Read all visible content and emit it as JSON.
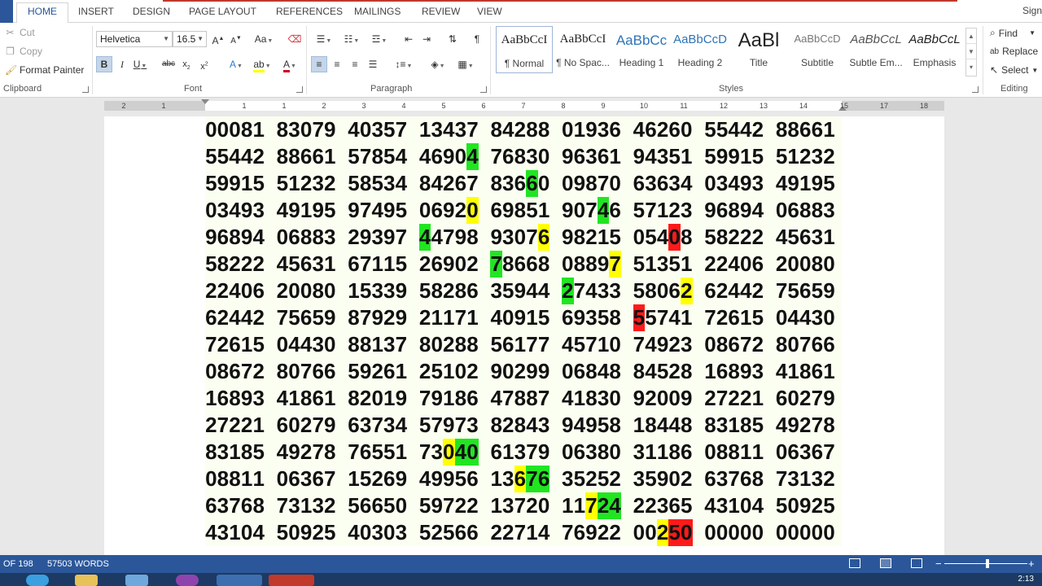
{
  "tabs": [
    "HOME",
    "INSERT",
    "DESIGN",
    "PAGE LAYOUT",
    "REFERENCES",
    "MAILINGS",
    "REVIEW",
    "VIEW"
  ],
  "active_tab": "HOME",
  "signin": "Sign",
  "clipboard": {
    "cut": "Cut",
    "copy": "Copy",
    "format_painter": "Format Painter",
    "label": "Clipboard"
  },
  "font": {
    "name": "Helvetica",
    "size": "16.5",
    "label": "Font"
  },
  "paragraph": {
    "label": "Paragraph"
  },
  "styles": {
    "label": "Styles",
    "items": [
      {
        "sample": "AaBbCcI",
        "name": "¶ Normal"
      },
      {
        "sample": "AaBbCcI",
        "name": "¶ No Spac..."
      },
      {
        "sample": "AaBbCc",
        "name": "Heading 1"
      },
      {
        "sample": "AaBbCcD",
        "name": "Heading 2"
      },
      {
        "sample": "AaBl",
        "name": "Title"
      },
      {
        "sample": "AaBbCcD",
        "name": "Subtitle"
      },
      {
        "sample": "AaBbCcL",
        "name": "Subtle Em..."
      },
      {
        "sample": "AaBbCcL",
        "name": "Emphasis"
      }
    ]
  },
  "editing": {
    "find": "Find",
    "replace": "Replace",
    "select": "Select",
    "label": "Editing"
  },
  "ruler_numbers": [
    "2",
    "1",
    "1",
    "1",
    "2",
    "3",
    "4",
    "5",
    "6",
    "7",
    "8",
    "9",
    "10",
    "11",
    "12",
    "13",
    "14",
    "15",
    "17",
    "18"
  ],
  "document": {
    "rows": [
      "00081 83079 40357 13437 84288 01936 46260 55442 88661",
      "55442 88661 57854 46904 76830 96361 94351 59915 51232",
      "59915 51232 58534 84267 83660 09870 63634 03493 49195",
      "03493 49195 97495 06920 69851 90746 57123 96894 06883",
      "96894 06883 29397 44798 93076 98215 05408 58222 45631",
      "58222 45631 67115 26902 78668 08897 51351 22406 20080",
      "22406 20080 15339 58286 35944 27433 58062 62442 75659",
      "62442 75659 87929 21171 40915 69358 55741 72615 04430",
      "72615 04430 88137 80288 56177 45710 74923 08672 80766",
      "08672 80766 59261 25102 90299 06848 84528 16893 41861",
      "16893 41861 82019 79186 47887 41830 92009 27221 60279",
      "27221 60279 63734 57973 82843 94958 18448 83185 49278",
      "83185 49278 76551 73040 61379 06380 31186 08811 06367",
      "08811 06367 15269 49956 13676 35252 35902 63768 73132",
      "63768 73132 56650 59722 13720 11724 22365 43104 50925",
      "43104 50925 40303 52566 22714 76922 00250 00000 00000"
    ],
    "highlights": [
      {
        "row": 1,
        "group": 3,
        "digit": 4,
        "color": "green"
      },
      {
        "row": 2,
        "group": 4,
        "digit": 3,
        "color": "green"
      },
      {
        "row": 3,
        "group": 3,
        "digit": 4,
        "color": "yellow"
      },
      {
        "row": 3,
        "group": 5,
        "digit": 3,
        "color": "green"
      },
      {
        "row": 4,
        "group": 3,
        "digit": 0,
        "color": "green"
      },
      {
        "row": 4,
        "group": 4,
        "digit": 4,
        "color": "yellow"
      },
      {
        "row": 4,
        "group": 6,
        "digit": 3,
        "color": "red"
      },
      {
        "row": 5,
        "group": 4,
        "digit": 0,
        "color": "green"
      },
      {
        "row": 5,
        "group": 5,
        "digit": 4,
        "color": "yellow"
      },
      {
        "row": 6,
        "group": 5,
        "digit": 0,
        "color": "green"
      },
      {
        "row": 6,
        "group": 6,
        "digit": 4,
        "color": "yellow"
      },
      {
        "row": 7,
        "group": 6,
        "digit": 0,
        "color": "red"
      },
      {
        "row": 12,
        "group": 3,
        "digit": 2,
        "color": "yellow"
      },
      {
        "row": 12,
        "group": 3,
        "digit": 3,
        "color": "green"
      },
      {
        "row": 12,
        "group": 3,
        "digit": 4,
        "color": "green"
      },
      {
        "row": 13,
        "group": 4,
        "digit": 2,
        "color": "yellow"
      },
      {
        "row": 13,
        "group": 4,
        "digit": 3,
        "color": "green"
      },
      {
        "row": 13,
        "group": 4,
        "digit": 4,
        "color": "green"
      },
      {
        "row": 14,
        "group": 5,
        "digit": 2,
        "color": "yellow"
      },
      {
        "row": 14,
        "group": 5,
        "digit": 3,
        "color": "green"
      },
      {
        "row": 14,
        "group": 5,
        "digit": 4,
        "color": "green"
      },
      {
        "row": 15,
        "group": 6,
        "digit": 2,
        "color": "yellow"
      },
      {
        "row": 15,
        "group": 6,
        "digit": 3,
        "color": "red"
      },
      {
        "row": 15,
        "group": 6,
        "digit": 4,
        "color": "red"
      }
    ]
  },
  "status": {
    "page": "OF 198",
    "words": "57503 WORDS"
  },
  "taskbar": {
    "clock": "2:13"
  },
  "colors": {
    "accent": "#2b579a",
    "green": "#22e522",
    "yellow": "#ffff00",
    "red": "#ff1a1a"
  }
}
